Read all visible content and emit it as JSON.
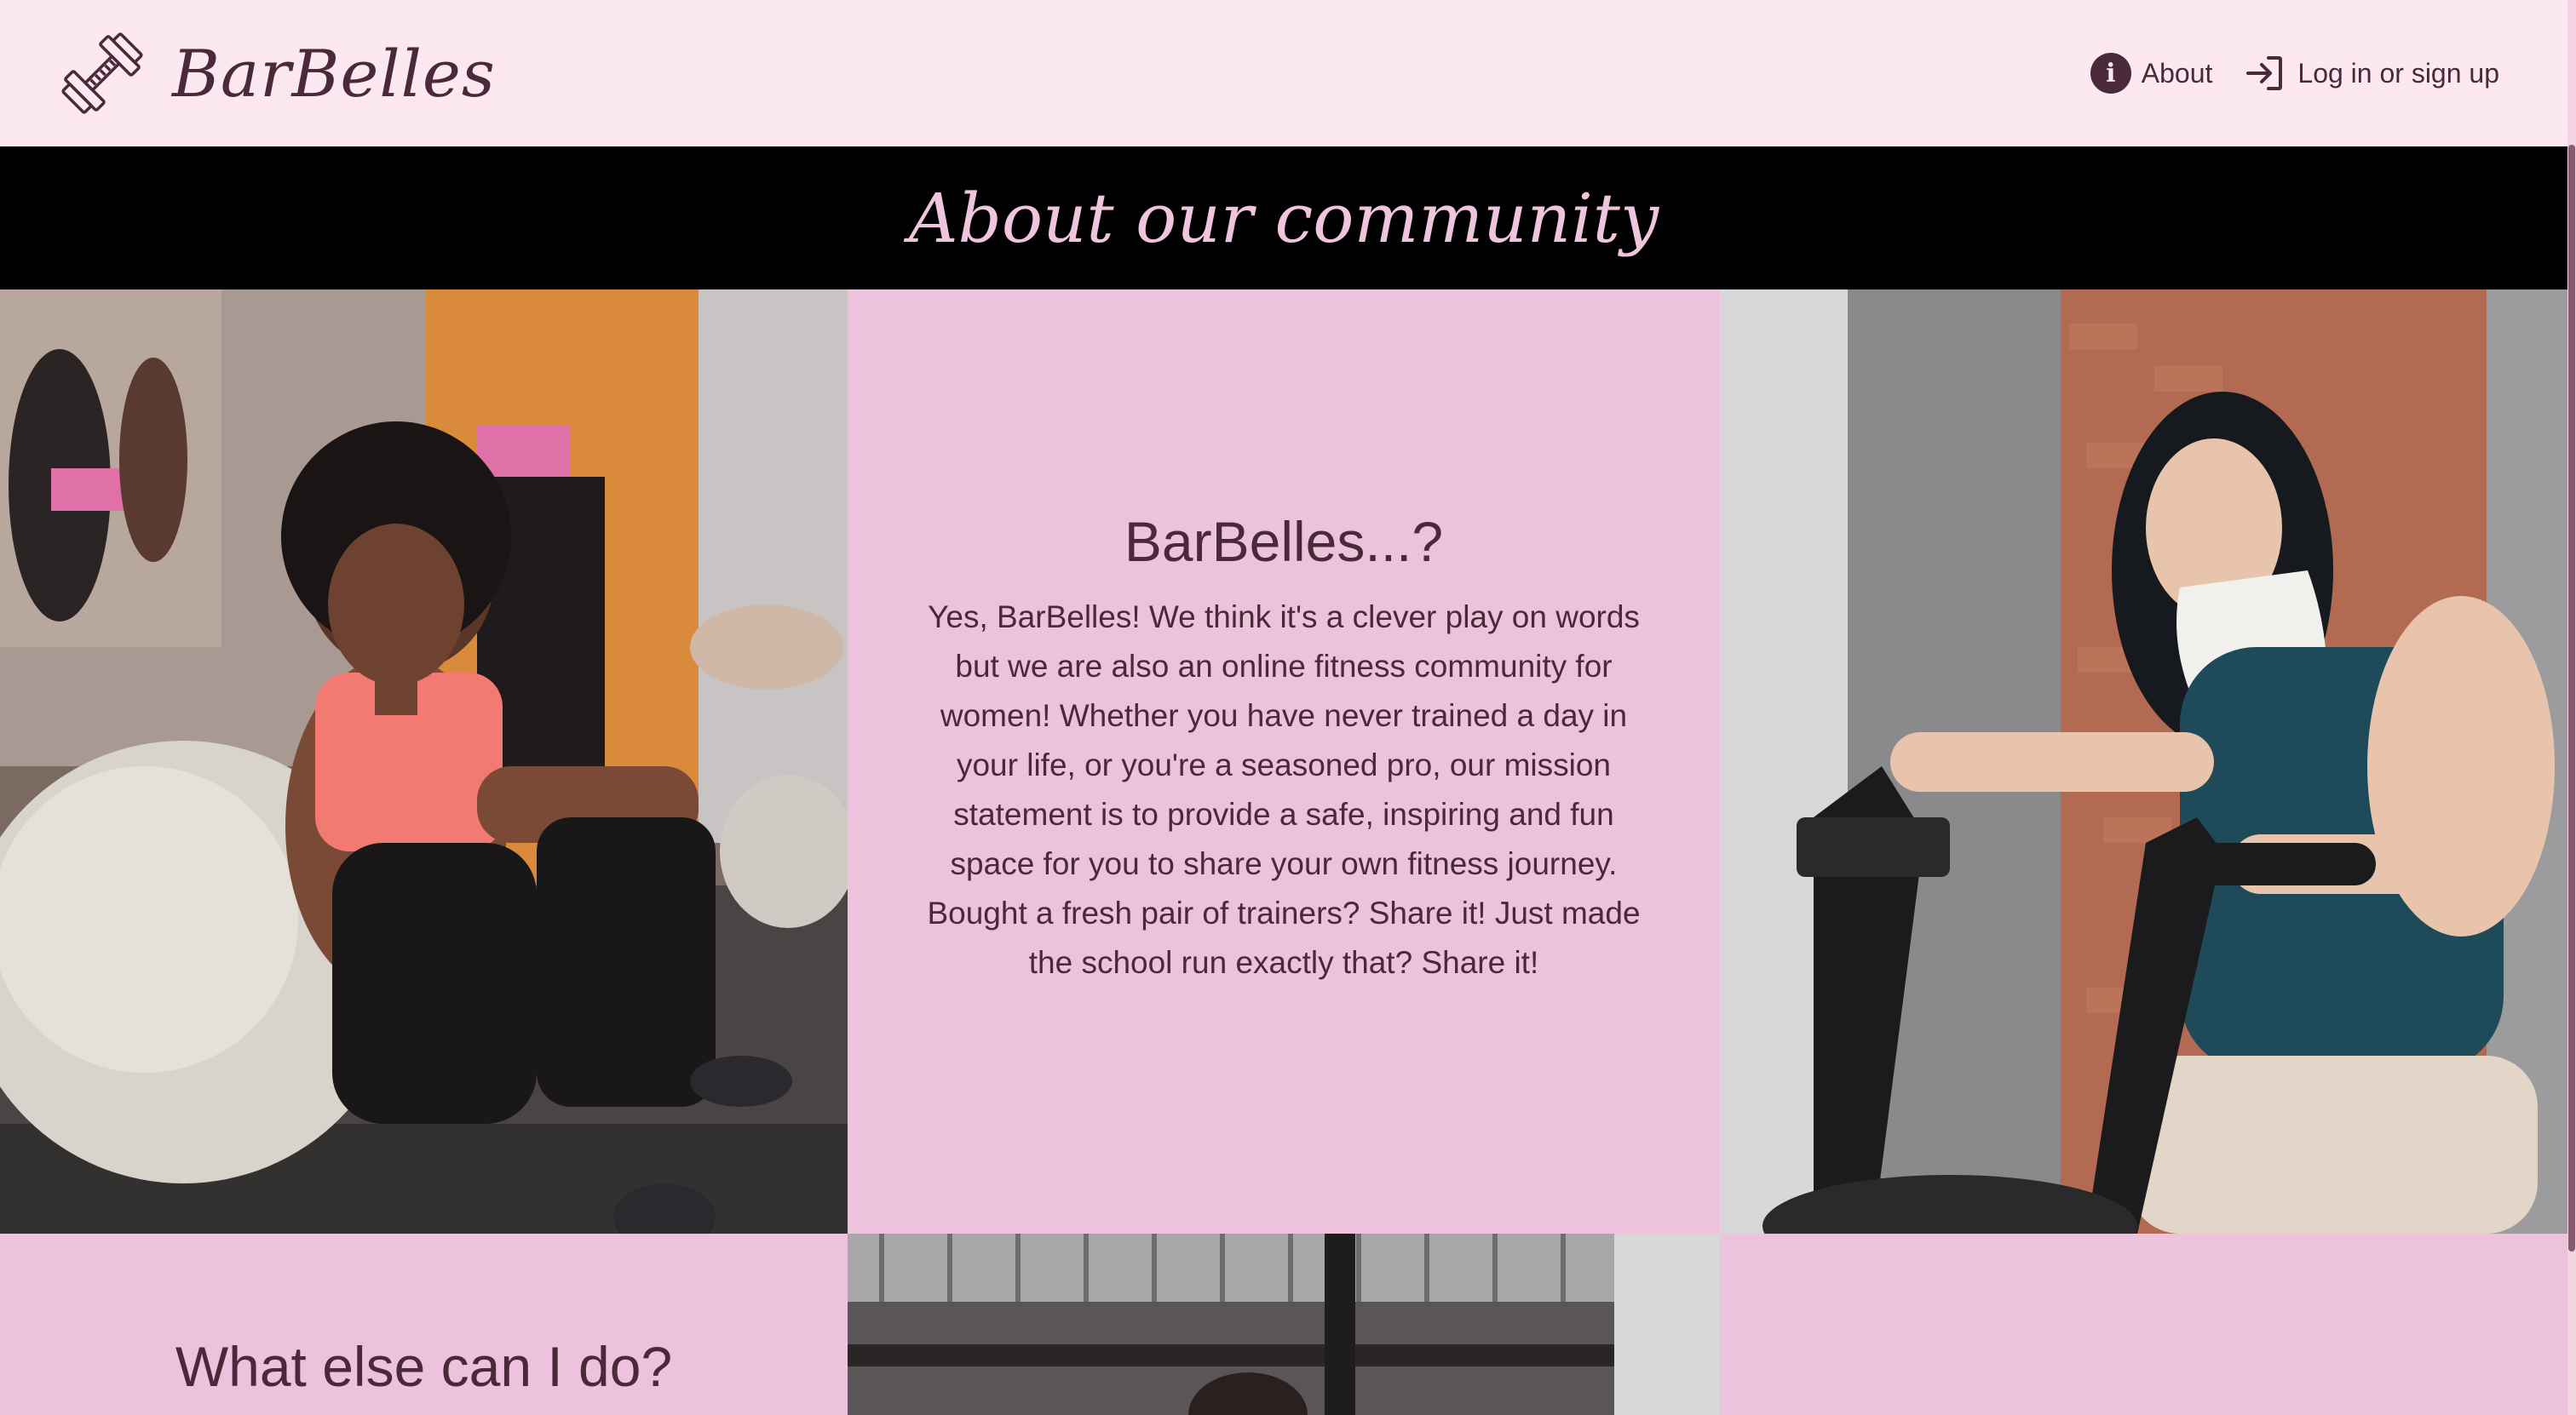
{
  "navbar": {
    "brand_name": "BarBelles",
    "about_label": "About",
    "login_label": "Log in or sign up",
    "logo_icon": "dumbbell-icon",
    "info_icon": "info-icon",
    "login_icon": "login-arrow-icon"
  },
  "banner": {
    "title": "About our community"
  },
  "intro": {
    "heading": "BarBelles...?",
    "body": "Yes, BarBelles! We think it's a clever play on words but we are also an online fitness community for women! Whether you have never trained a day in your life, or you're a seasoned pro, our mission statement is to provide a safe, inspiring and fun space for you to share your own fitness journey. Bought a fresh pair of trainers? Share it! Just made the school run exactly that? Share it!"
  },
  "section2": {
    "heading": "What else can I do?"
  },
  "colors": {
    "nav_bg": "#fce8f1",
    "banner_bg": "#000000",
    "banner_text": "#efc4dd",
    "panel_pink": "#edc2dc",
    "text_dark": "#4a2a38"
  }
}
